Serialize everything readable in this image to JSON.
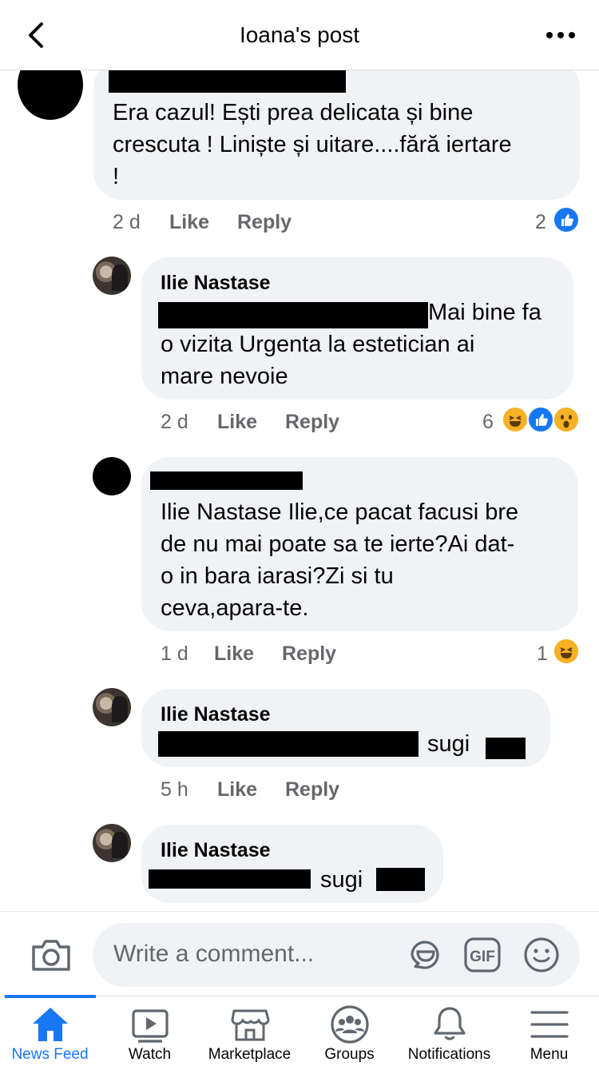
{
  "header": {
    "title": "Ioana's post",
    "back_icon": "chevron-left-icon",
    "more_icon": "more-horizontal-icon"
  },
  "comments": [
    {
      "author": "",
      "text": "Era cazul! Ești prea delicata și bine crescuta ! Liniște și uitare....fără iertare !",
      "text_lines": [
        "Era cazul! Ești prea delicata și bine",
        "crescuta ! Liniște și uitare....fără iertare",
        "!"
      ],
      "time": "2 d",
      "like_label": "Like",
      "reply_label": "Reply",
      "reaction_count": "2",
      "reactions": [
        "like"
      ]
    },
    {
      "author": "Ilie Nastase",
      "text_lines": [
        "Mai bine fa",
        "o vizita Urgenta la estetician ai",
        "mare nevoie"
      ],
      "time": "2 d",
      "like_label": "Like",
      "reply_label": "Reply",
      "reaction_count": "6",
      "reactions": [
        "haha",
        "like",
        "wow"
      ]
    },
    {
      "author": "",
      "text_lines": [
        "Ilie Nastase Ilie,ce pacat facusi bre",
        "de nu mai poate sa te ierte?Ai dat-",
        "o in bara iarasi?Zi si tu",
        "ceva,apara-te."
      ],
      "time": "1 d",
      "like_label": "Like",
      "reply_label": "Reply",
      "reaction_count": "1",
      "reactions": [
        "haha"
      ]
    },
    {
      "author": "Ilie Nastase",
      "text_lines": [
        "sugi"
      ],
      "time": "5 h",
      "like_label": "Like",
      "reply_label": "Reply"
    },
    {
      "author": "Ilie Nastase",
      "text_lines": [
        "sugi"
      ]
    }
  ],
  "composer": {
    "placeholder": "Write a comment...",
    "camera_icon": "camera-icon",
    "sticker_icon": "sticker-icon",
    "gif_label": "GIF",
    "emoji_icon": "emoji-icon"
  },
  "nav": {
    "items": [
      {
        "label": "News Feed",
        "icon": "home-icon",
        "active": true
      },
      {
        "label": "Watch",
        "icon": "watch-icon"
      },
      {
        "label": "Marketplace",
        "icon": "marketplace-icon"
      },
      {
        "label": "Groups",
        "icon": "groups-icon"
      },
      {
        "label": "Notifications",
        "icon": "bell-icon"
      },
      {
        "label": "Menu",
        "icon": "menu-icon"
      }
    ]
  },
  "colors": {
    "accent": "#1877f2",
    "bubble": "#f0f2f5",
    "secondary_text": "#65676b",
    "haha_wow": "#f7b125"
  }
}
